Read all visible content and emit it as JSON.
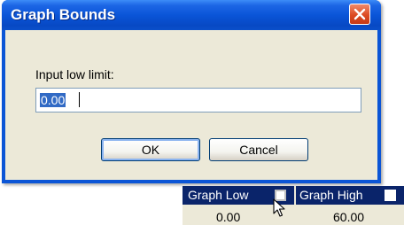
{
  "dialog": {
    "title": "Graph Bounds",
    "close_icon": "close-x-icon",
    "prompt_label": "Input low limit:",
    "input_value": "0.00",
    "ok_label": "OK",
    "cancel_label": "Cancel"
  },
  "table": {
    "columns": [
      {
        "header": "Graph Low",
        "value": "0.00"
      },
      {
        "header": "Graph High",
        "value": "60.00"
      }
    ]
  },
  "colors": {
    "titlebar": "#0a55d8",
    "close_button": "#dc4b23",
    "dialog_face": "#ece9d8",
    "selection": "#316ac5",
    "header_bg": "#0a246a"
  }
}
